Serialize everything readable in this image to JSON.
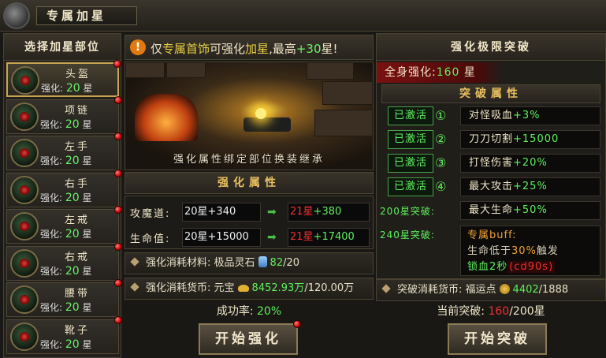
{
  "window": {
    "title": "专属加星"
  },
  "left": {
    "header": "选择加星部位",
    "slots": [
      {
        "name": "头盔",
        "label": "强化:",
        "level": "20",
        "unit": "星",
        "selected": true
      },
      {
        "name": "项链",
        "label": "强化:",
        "level": "20",
        "unit": "星"
      },
      {
        "name": "左手",
        "label": "强化:",
        "level": "20",
        "unit": "星"
      },
      {
        "name": "右手",
        "label": "强化:",
        "level": "20",
        "unit": "星"
      },
      {
        "name": "左戒",
        "label": "强化:",
        "level": "20",
        "unit": "星"
      },
      {
        "name": "右戒",
        "label": "强化:",
        "level": "20",
        "unit": "星"
      },
      {
        "name": "腰带",
        "label": "强化:",
        "level": "20",
        "unit": "星"
      },
      {
        "name": "靴子",
        "label": "强化:",
        "level": "20",
        "unit": "星"
      }
    ]
  },
  "notice": {
    "icon": "!",
    "p1": "仅",
    "p2": "专属首饰",
    "p3": "可强化",
    "p4": "加星",
    "p5": ",最高",
    "p6": "+30",
    "p7": "星!"
  },
  "scene": {
    "caption": "强化属性绑定部位换装继承"
  },
  "attributes": {
    "header": "强化属性",
    "rows": [
      {
        "label": "攻魔道:",
        "current": "20星+340",
        "next_stars": "21星",
        "next_bonus": "+380"
      },
      {
        "label": "生命值:",
        "current": "20星+15000",
        "next_stars": "21星",
        "next_bonus": "+17400"
      }
    ]
  },
  "cost_material": {
    "label": "强化消耗材料:",
    "item": "极品灵石",
    "have": "82",
    "need": "/20"
  },
  "cost_currency": {
    "label": "强化消耗货币:",
    "item": "元宝",
    "have": "8452.93万",
    "need": "/120.00万"
  },
  "cost_break": {
    "label": "突破消耗货币:",
    "item": "福运点",
    "have": "4402",
    "need": "/1888"
  },
  "success": {
    "label": "成功率:",
    "value": "20%"
  },
  "buttons": {
    "enhance": "开始强化",
    "breakthrough": "开始突破"
  },
  "right": {
    "header": "强化极限突破",
    "total_label": "全身强化:",
    "total_value": "160",
    "total_unit": "星",
    "break_header": "突破属性",
    "rows": [
      {
        "badge": "已激活",
        "index": "①",
        "text": "对怪吸血",
        "bonus": "+3%"
      },
      {
        "badge": "已激活",
        "index": "②",
        "text": "刀刀切割",
        "bonus": "+15000"
      },
      {
        "badge": "已激活",
        "index": "③",
        "text": "打怪伤害",
        "bonus": "+20%"
      },
      {
        "badge": "已激活",
        "index": "④",
        "text": "最大攻击",
        "bonus": "+25%"
      }
    ],
    "tier200": {
      "label": "200星突破:",
      "text": "最大生命",
      "bonus": "+50%"
    },
    "tier240": {
      "label": "240星突破:",
      "buff_title": "专属buff:",
      "l2a": "生命低于",
      "l2b": "30%",
      "l2c": "触发",
      "l3a": "锁血2秒",
      "l3b": "(cd90s)"
    }
  },
  "current": {
    "label": "当前突破:",
    "value": "160",
    "max": "/200星"
  },
  "colors": {
    "accent_green": "#5ef05e",
    "accent_red": "#f03030",
    "gold": "#e8c060"
  }
}
